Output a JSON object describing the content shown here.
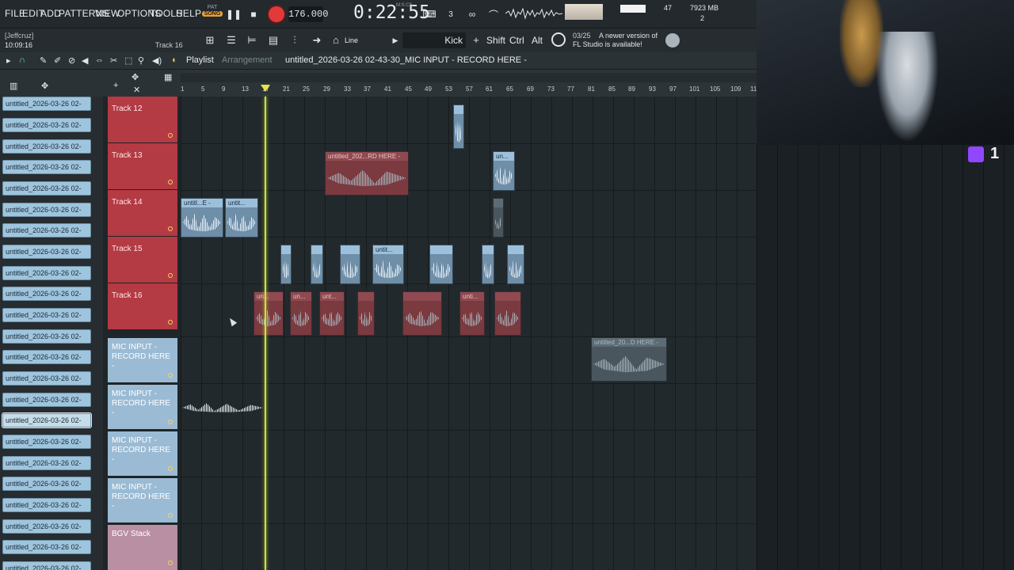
{
  "menu": {
    "items": [
      "FILE",
      "EDIT",
      "ADD",
      "PATTERNS",
      "VIEW",
      "OPTIONS",
      "TOOLS",
      "HELP"
    ],
    "pat_label": "PAT",
    "song_label": "SONG"
  },
  "transport": {
    "tempo": "176.000",
    "time": "0:22:55",
    "time_unit": "M:S:CS",
    "cpu": "47",
    "memory": "7923 MB",
    "polyphony": "2"
  },
  "toolbar2": {
    "user": "[Jeffcruz]",
    "clock": "10:09:16",
    "track_hint": "Track 16",
    "snap": "Line",
    "channel": "Kick",
    "mod_keys": [
      "Shift",
      "Ctrl",
      "Alt"
    ],
    "news_date": "03/25",
    "news_line1": "A newer version of",
    "news_line2": "FL Studio is available!"
  },
  "playlist": {
    "title": "Playlist",
    "subtitle": "Arrangement",
    "project": "untitled_2026-03-26 02-43-30_MIC INPUT - RECORD HERE -"
  },
  "ruler": {
    "ticks": [
      "1",
      "5",
      "9",
      "13",
      "17",
      "21",
      "25",
      "29",
      "33",
      "37",
      "41",
      "45",
      "49",
      "53",
      "57",
      "61",
      "65",
      "69",
      "73",
      "77",
      "81",
      "85",
      "89",
      "93",
      "97",
      "101",
      "105",
      "109",
      "11"
    ]
  },
  "browser": {
    "patterns": [
      "untitled_2026-03-26 02-",
      "untitled_2026-03-26 02-",
      "untitled_2026-03-26 02-",
      "untitled_2026-03-26 02-",
      "untitled_2026-03-26 02-",
      "untitled_2026-03-26 02-",
      "untitled_2026-03-26 02-",
      "untitled_2026-03-26 02-",
      "untitled_2026-03-26 02-",
      "untitled_2026-03-26 02-",
      "untitled_2026-03-26 02-",
      "untitled_2026-03-26 02-",
      "untitled_2026-03-26 02-",
      "untitled_2026-03-26 02-",
      "untitled_2026-03-26 02-",
      "untitled_2026-03-26 02-",
      "untitled_2026-03-26 02-",
      "untitled_2026-03-26 02-",
      "untitled_2026-03-26 02-",
      "untitled_2026-03-26 02-",
      "untitled_2026-03-26 02-",
      "untitled_2026-03-26 02-",
      "untitled_2026-03-26 02-"
    ]
  },
  "tracks": [
    {
      "name": "Track 12"
    },
    {
      "name": "Track 13"
    },
    {
      "name": "Track 14"
    },
    {
      "name": "Track 15"
    },
    {
      "name": "Track 16"
    },
    {
      "name": "MIC INPUT - RECORD HERE -"
    },
    {
      "name": "MIC INPUT - RECORD HERE -"
    },
    {
      "name": "MIC INPUT - RECORD HERE -"
    },
    {
      "name": "MIC INPUT - RECORD HERE -"
    },
    {
      "name": "BGV Stack"
    }
  ],
  "clips": {
    "c1": "untitled_202...RD HERE -",
    "c2": "un...",
    "c3": "untitl...E -",
    "c4": "untit...",
    "c5": "untit...",
    "c6": "un...",
    "c7": "un...",
    "c8": "unt...",
    "c9": "unti...",
    "c10": "untitled_20...D HERE -"
  },
  "stream": {
    "viewer_count": "1"
  },
  "colors": {
    "accent": "#e8a13a",
    "record": "#e23a3a",
    "playhead": "#c7e23e",
    "track_red": "#b43a43",
    "track_blue": "#9bbbd4",
    "clip_blue": "#9cc0db"
  }
}
